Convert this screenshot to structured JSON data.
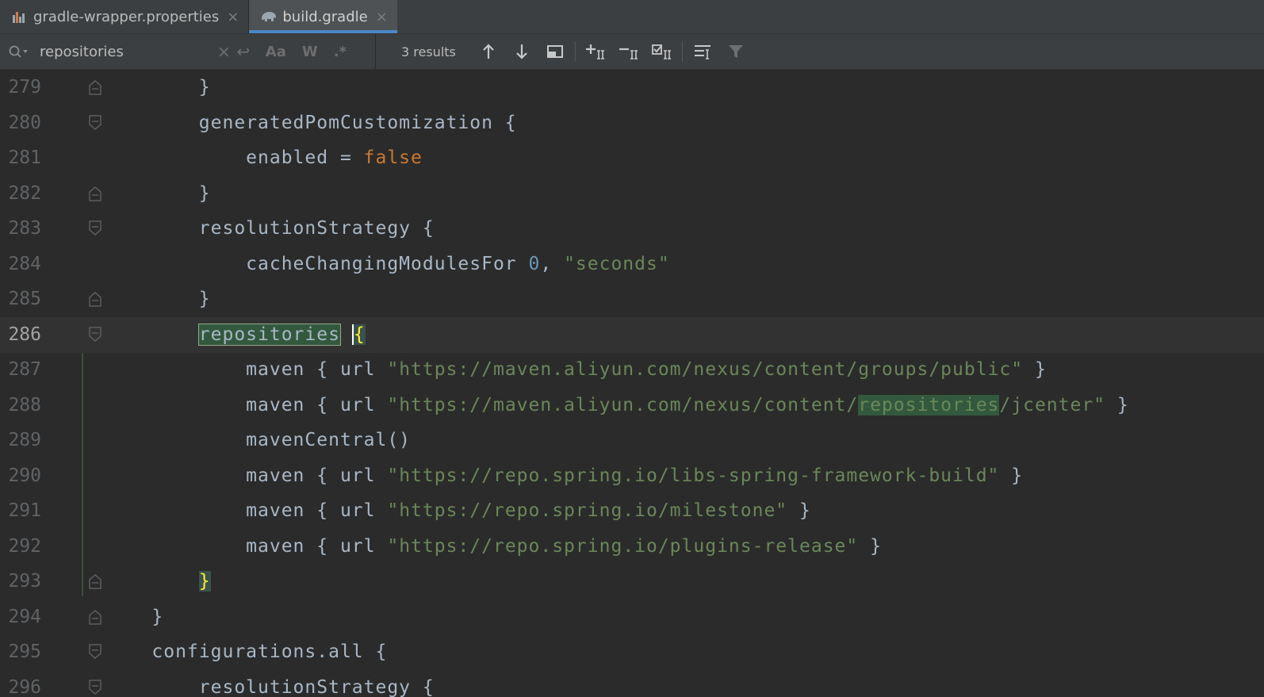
{
  "tabs": [
    {
      "label": "gradle-wrapper.properties",
      "active": false
    },
    {
      "label": "build.gradle",
      "active": true
    }
  ],
  "find": {
    "query": "repositories",
    "results": "3 results",
    "opt_case": "Aa",
    "opt_words": "W",
    "opt_regex": ".*"
  },
  "editor": {
    "current_line": 286,
    "lines": [
      {
        "num": "279",
        "code": "        }"
      },
      {
        "num": "280",
        "code": "        generatedPomCustomization {"
      },
      {
        "num": "281",
        "code_parts": [
          "            enabled = ",
          "false"
        ]
      },
      {
        "num": "282",
        "code": "        }"
      },
      {
        "num": "283",
        "code": "        resolutionStrategy {"
      },
      {
        "num": "284",
        "code_parts": [
          "            cacheChangingModulesFor ",
          "0",
          ", ",
          "\"seconds\""
        ]
      },
      {
        "num": "285",
        "code": "        }"
      },
      {
        "num": "286",
        "code_parts": [
          "        ",
          "repositories",
          " ",
          "{"
        ]
      },
      {
        "num": "287",
        "code_parts": [
          "            maven { url ",
          "\"https://maven.aliyun.com/nexus/content/groups/public\"",
          " }"
        ]
      },
      {
        "num": "288",
        "code_parts": [
          "            maven { url ",
          "\"https://maven.aliyun.com/nexus/content/",
          "repositories",
          "/jcenter\"",
          " }"
        ]
      },
      {
        "num": "289",
        "code": "            mavenCentral()"
      },
      {
        "num": "290",
        "code_parts": [
          "            maven { url ",
          "\"https://repo.spring.io/libs-spring-framework-build\"",
          " }"
        ]
      },
      {
        "num": "291",
        "code_parts": [
          "            maven { url ",
          "\"https://repo.spring.io/milestone\"",
          " }"
        ]
      },
      {
        "num": "292",
        "code_parts": [
          "            maven { url ",
          "\"https://repo.spring.io/plugins-release\"",
          " }"
        ]
      },
      {
        "num": "293",
        "code_parts": [
          "        ",
          "}"
        ]
      },
      {
        "num": "294",
        "code": "    }"
      },
      {
        "num": "295",
        "code": "    configurations.all {"
      },
      {
        "num": "296",
        "code": "        resolutionStrategy {"
      }
    ]
  },
  "colors": {
    "background": "#2b2b2b",
    "keyword": "#cc7832",
    "string": "#6a8759",
    "number": "#6897bb",
    "match_highlight": "#32593d",
    "accent_tab": "#4a88c7"
  }
}
